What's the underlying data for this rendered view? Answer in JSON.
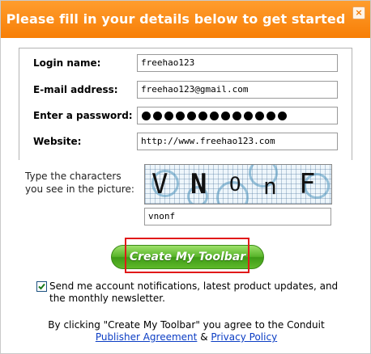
{
  "header": {
    "title": "Please fill in your details below to get started",
    "close_glyph": "×"
  },
  "form": {
    "login": {
      "label": "Login name:",
      "value": "freehao123"
    },
    "email": {
      "label": "E-mail address:",
      "value": "freehao123@gmail.com"
    },
    "password": {
      "label": "Enter a password:",
      "masked_length": 13
    },
    "website": {
      "label": "Website:",
      "value": "http://www.freehao123.com"
    }
  },
  "captcha": {
    "label": "Type the characters you see in the picture:",
    "image_text": [
      "V",
      "N",
      "O",
      "n",
      "F"
    ],
    "input_value": "vnonf"
  },
  "create_button": {
    "label": "Create My Toolbar"
  },
  "newsletter": {
    "checked": true,
    "text": "Send me account notifications, latest product updates, and the monthly newsletter."
  },
  "terms": {
    "prefix": "By clicking \"Create My Toolbar\" you agree to the Conduit",
    "publisher_link": "Publisher Agreement",
    "amp": "&",
    "privacy_link": "Privacy Policy"
  },
  "colors": {
    "header": "#f77e06",
    "button": "#4fa823",
    "highlight": "#e11919",
    "link": "#0b3dc4"
  }
}
